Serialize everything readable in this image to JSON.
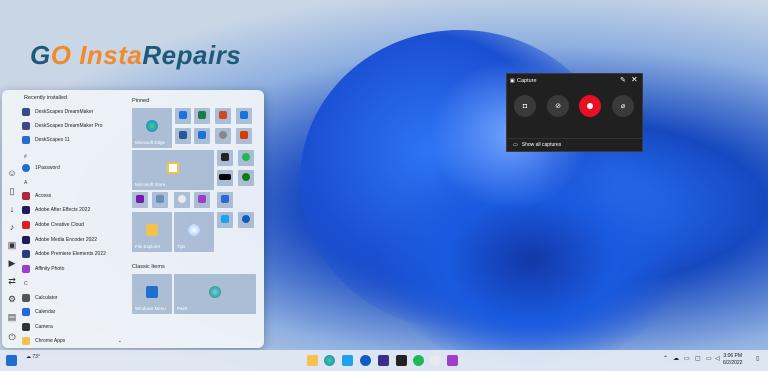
{
  "brand": {
    "go": "G",
    "o_char": "O",
    "insta": "Insta",
    "repairs": "Repairs"
  },
  "start_menu": {
    "recently_installed_label": "Recently installed",
    "pinned_label": "Pinned",
    "classic_items_label": "Classic Items",
    "recent_apps": [
      "DeskScapes DreamMaker",
      "DeskScapes DreamMaker Pro",
      "DeskScapes 11"
    ],
    "numbers_header": "#",
    "number_apps": [
      "1Password"
    ],
    "letter_a": "A",
    "a_apps": [
      "Access",
      "Adobe After Effects 2022",
      "Adobe Creative Cloud",
      "Adobe Media Encoder 2022",
      "Adobe Premiere Elements 2022",
      "Affinity Photo"
    ],
    "letter_c": "C",
    "c_apps": [
      "Calculator",
      "Calendar",
      "Camera",
      "Chrome Apps"
    ],
    "tiles": {
      "microsoft_edge": "Microsoft Edge",
      "microsoft_store": "Microsoft Store",
      "file_explorer": "File Explorer",
      "tips": "Tips",
      "windows_menu": "Windows Menu",
      "paint": "Paint"
    }
  },
  "capture": {
    "title": "Capture",
    "show_all": "Show all captures"
  },
  "taskbar": {
    "weather": "73°",
    "time": "3:06 PM",
    "date": "6/2/2022"
  },
  "colors": {
    "accent": "#1f5fe0",
    "record": "#e81123",
    "brand_orange": "#f08a2a",
    "brand_teal": "#1e5a78"
  }
}
